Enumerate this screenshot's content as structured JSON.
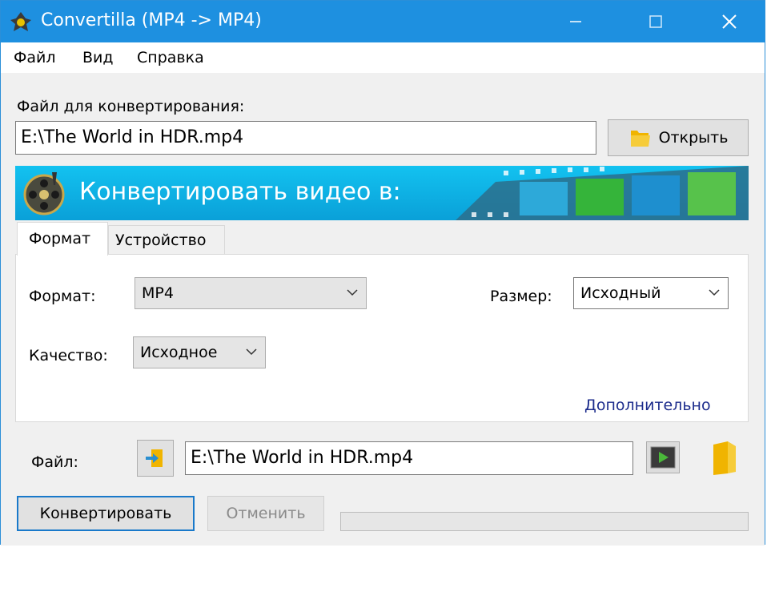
{
  "window": {
    "title": "Convertilla  (MP4 -> MP4)",
    "title_color": "#1e90e0",
    "controls": {
      "minimize": "minimize-icon",
      "maximize": "maximize-icon",
      "close": "close-icon"
    }
  },
  "menu": {
    "items": [
      "Файл",
      "Вид",
      "Справка"
    ]
  },
  "source": {
    "label": "Файл для конвертирования:",
    "path": "E:\\The World in HDR.mp4",
    "open_label": "Открыть",
    "open_icon": "folder-icon"
  },
  "banner": {
    "text": "Конвертировать видео в:",
    "icon": "film-reel-icon"
  },
  "tabs": [
    "Формат",
    "Устройство"
  ],
  "format_tab": {
    "format_label": "Формат:",
    "format_value": "MP4",
    "size_label": "Размер:",
    "size_value": "Исходный",
    "quality_label": "Качество:",
    "quality_value": "Исходное",
    "advanced_link": "Дополнительно"
  },
  "output": {
    "label": "Файл:",
    "path": "E:\\The World in HDR.mp4",
    "icons": [
      "import-file-icon",
      "play-video-icon",
      "folder-icon"
    ]
  },
  "actions": {
    "convert_label": "Конвертировать",
    "cancel_label": "Отменить",
    "progress": 0
  }
}
